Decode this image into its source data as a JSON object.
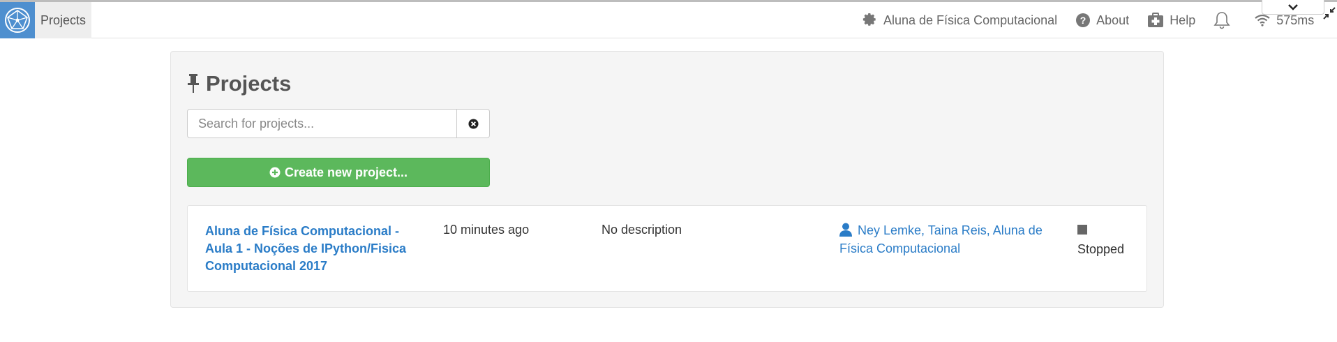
{
  "topbar": {
    "projects_tab": "Projects",
    "account": "Aluna de Física Computacional",
    "about": "About",
    "help": "Help",
    "ping": "575ms"
  },
  "main": {
    "title": "Projects",
    "search": {
      "placeholder": "Search for projects...",
      "value": ""
    },
    "create_button": "Create new project...",
    "projects": [
      {
        "title": "Aluna de Física Computacional - Aula 1 - Noções de IPython/Fisica Computacional 2017",
        "last_edited": "10 minutes ago",
        "description": "No description",
        "users": "Ney Lemke, Taina Reis, Aluna de Física Computacional",
        "state": "Stopped"
      }
    ]
  },
  "colors": {
    "accent_blue": "#2a7cc7",
    "create_green": "#5cb85c",
    "logo_blue": "#4e8fcf"
  },
  "icons": [
    "logo-icon",
    "gear-icon",
    "question-circle-icon",
    "medkit-icon",
    "bell-icon",
    "wifi-icon",
    "chevron-down-icon",
    "compress-icon",
    "thumbtack-icon",
    "times-circle-icon",
    "plus-circle-icon",
    "user-icon",
    "stop-icon"
  ]
}
